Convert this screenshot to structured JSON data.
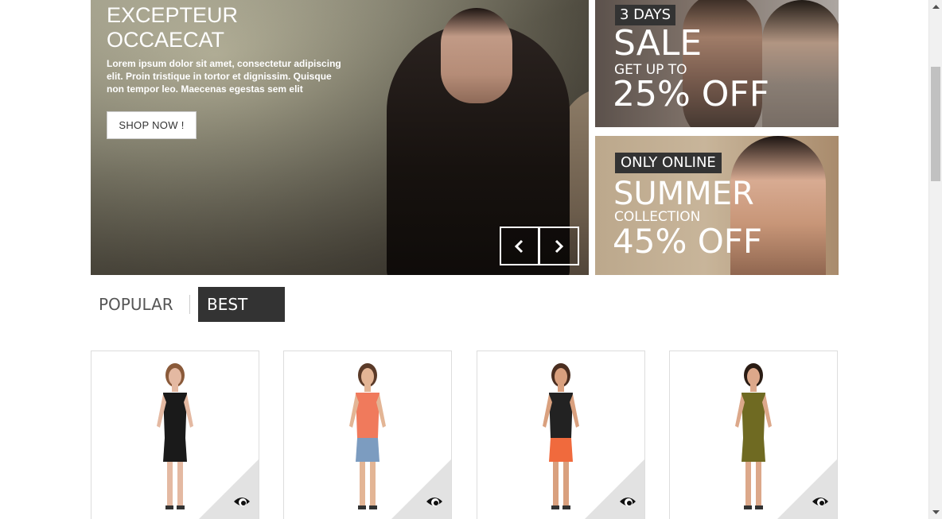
{
  "hero": {
    "title": "EXCEPTEUR\nOCCAECAT",
    "text": "Lorem ipsum dolor sit amet, consectetur adipiscing elit. Proin tristique in tortor et dignissim. Quisque non tempor leo. Maecenas egestas sem elit",
    "button": "SHOP NOW !",
    "prev_icon": "chevron-left-icon",
    "next_icon": "chevron-right-icon"
  },
  "banner1": {
    "tag": "3 DAYS",
    "headline": "SALE",
    "sub": "GET UP TO",
    "discount": "25% OFF"
  },
  "banner2": {
    "tag": "ONLY ONLINE",
    "headline": "SUMMER",
    "sub": "COLLECTION",
    "discount": "45% OFF"
  },
  "tabs": [
    {
      "label": "POPULAR",
      "active": false
    },
    {
      "label": "BEST SELLERS",
      "active": true
    }
  ],
  "products": [
    {
      "name": "black-outfit",
      "colors": {
        "top": "#1a1a1a",
        "bottom": "#1a1a1a",
        "skin": "#e4b9a2",
        "hair": "#8a5a3a"
      },
      "icon": "eye-icon"
    },
    {
      "name": "coral-top-denim-shorts",
      "colors": {
        "top": "#f07a5c",
        "bottom": "#7c9cc0",
        "skin": "#e3b595",
        "hair": "#5a3a28"
      },
      "icon": "eye-icon"
    },
    {
      "name": "striped-top-orange-skirt",
      "colors": {
        "top": "#222222",
        "bottom": "#f06a3d",
        "skin": "#d9a07e",
        "hair": "#4a2e20"
      },
      "icon": "eye-icon"
    },
    {
      "name": "floral-dress",
      "colors": {
        "top": "#6f6a22",
        "bottom": "#6f6a22",
        "skin": "#dca88a",
        "hair": "#2a1c14"
      },
      "icon": "eye-icon"
    }
  ],
  "scrollbar": {
    "up_icon": "arrow-up-icon",
    "down_icon": "arrow-down-icon"
  }
}
